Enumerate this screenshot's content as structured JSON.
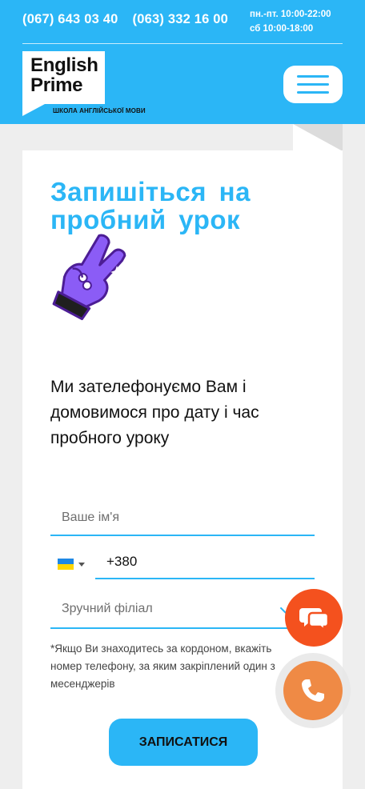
{
  "header": {
    "phones": [
      "(067) 643 03 40",
      "(063) 332 16 00"
    ],
    "hours": [
      "пн.-пт. 10:00-22:00",
      "сб 10:00-18:00"
    ],
    "logo": {
      "line1": "English",
      "line2": "Prime"
    },
    "tagline": "ШКОЛА АНГЛІЙСЬКОЇ МОВИ",
    "menu_icon": "hamburger-icon"
  },
  "form": {
    "title": "Запишіться на пробний урок",
    "illustration_icon": "victory-hand-icon",
    "subtitle": "Ми зателефонуємо Вам і домовимося про дату і час пробного уроку",
    "name_placeholder": "Ваше ім'я",
    "country_flag_icon": "ukraine-flag-icon",
    "phone_value": "+380",
    "branch_placeholder": "Зручний філіал",
    "note": "*Якщо Ви знаходитесь за кордоном, вкажіть номер телефону, за яким закріплений один з месенджерів",
    "submit_label": "ЗАПИСАТИСЯ"
  },
  "floating": {
    "chat_icon": "chat-bubbles-icon",
    "call_icon": "phone-handset-icon"
  },
  "colors": {
    "accent": "#2bb6f6",
    "chat": "#f4511e",
    "call": "#ef8a45",
    "hand": "#8b5cf6"
  }
}
